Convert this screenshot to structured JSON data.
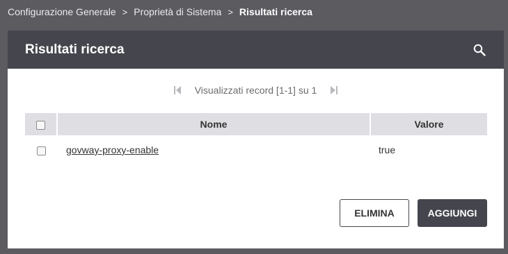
{
  "breadcrumb": {
    "items": [
      "Configurazione Generale",
      "Proprietà di Sistema"
    ],
    "current": "Risultati ricerca",
    "separator": ">"
  },
  "panel": {
    "title": "Risultati ricerca",
    "search_icon": "search-icon"
  },
  "pager": {
    "text": "Visualizzati record [1-1] su 1",
    "first_icon": "first-page-icon",
    "last_icon": "last-page-icon"
  },
  "table": {
    "columns": [
      "Nome",
      "Valore"
    ],
    "rows": [
      {
        "nome": "govway-proxy-enable",
        "valore": "true"
      }
    ]
  },
  "actions": {
    "delete_label": "ELIMINA",
    "add_label": "AGGIUNGI"
  },
  "colors": {
    "background": "#5b5b60",
    "header": "#45464d",
    "table_header": "#dfdfe3"
  }
}
